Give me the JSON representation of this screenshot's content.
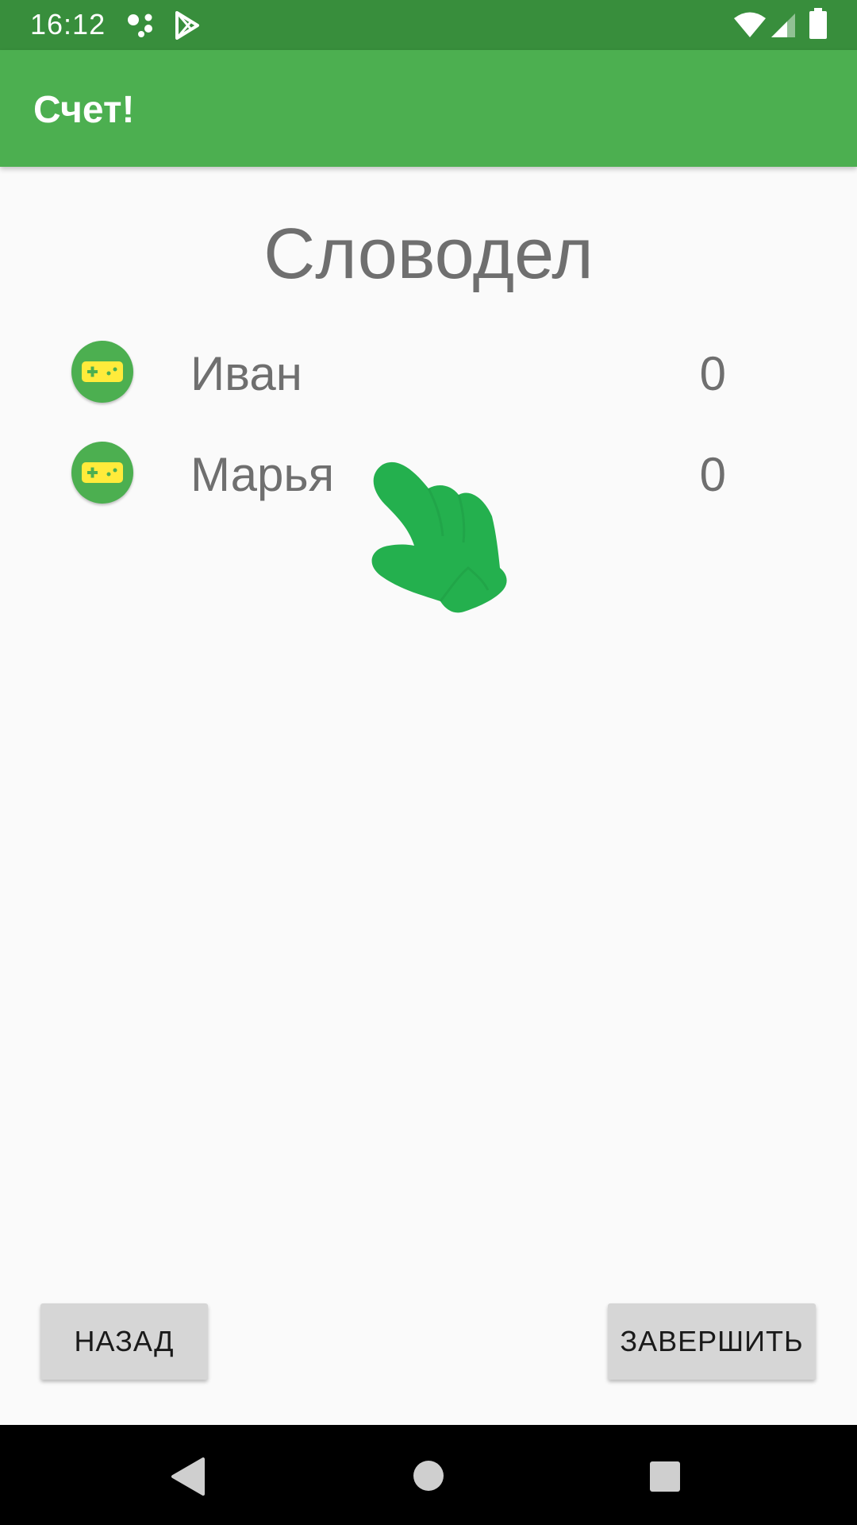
{
  "status_bar": {
    "time": "16:12",
    "icons": [
      "assistant-dots-icon",
      "play-store-icon",
      "wifi-icon",
      "signal-icon",
      "battery-icon"
    ]
  },
  "app_bar": {
    "title": "Счет!"
  },
  "game": {
    "title": "Словодел"
  },
  "players": [
    {
      "name": "Иван",
      "score": "0",
      "icon": "gamepad-icon"
    },
    {
      "name": "Марья",
      "score": "0",
      "icon": "gamepad-icon"
    }
  ],
  "overlay": {
    "icon": "pointing-hand-icon",
    "color": "#24b04e"
  },
  "buttons": {
    "back_label": "НАЗАД",
    "finish_label": "ЗАВЕРШИТЬ"
  },
  "nav_bar": {
    "icons": [
      "back-icon",
      "home-icon",
      "recents-icon"
    ]
  },
  "colors": {
    "status_bar": "#388e3c",
    "app_bar": "#4caf50",
    "avatar": "#4caf50",
    "gamepad": "#ffeb3b",
    "text_gray": "#6f6f6f",
    "button": "#d6d6d6"
  }
}
